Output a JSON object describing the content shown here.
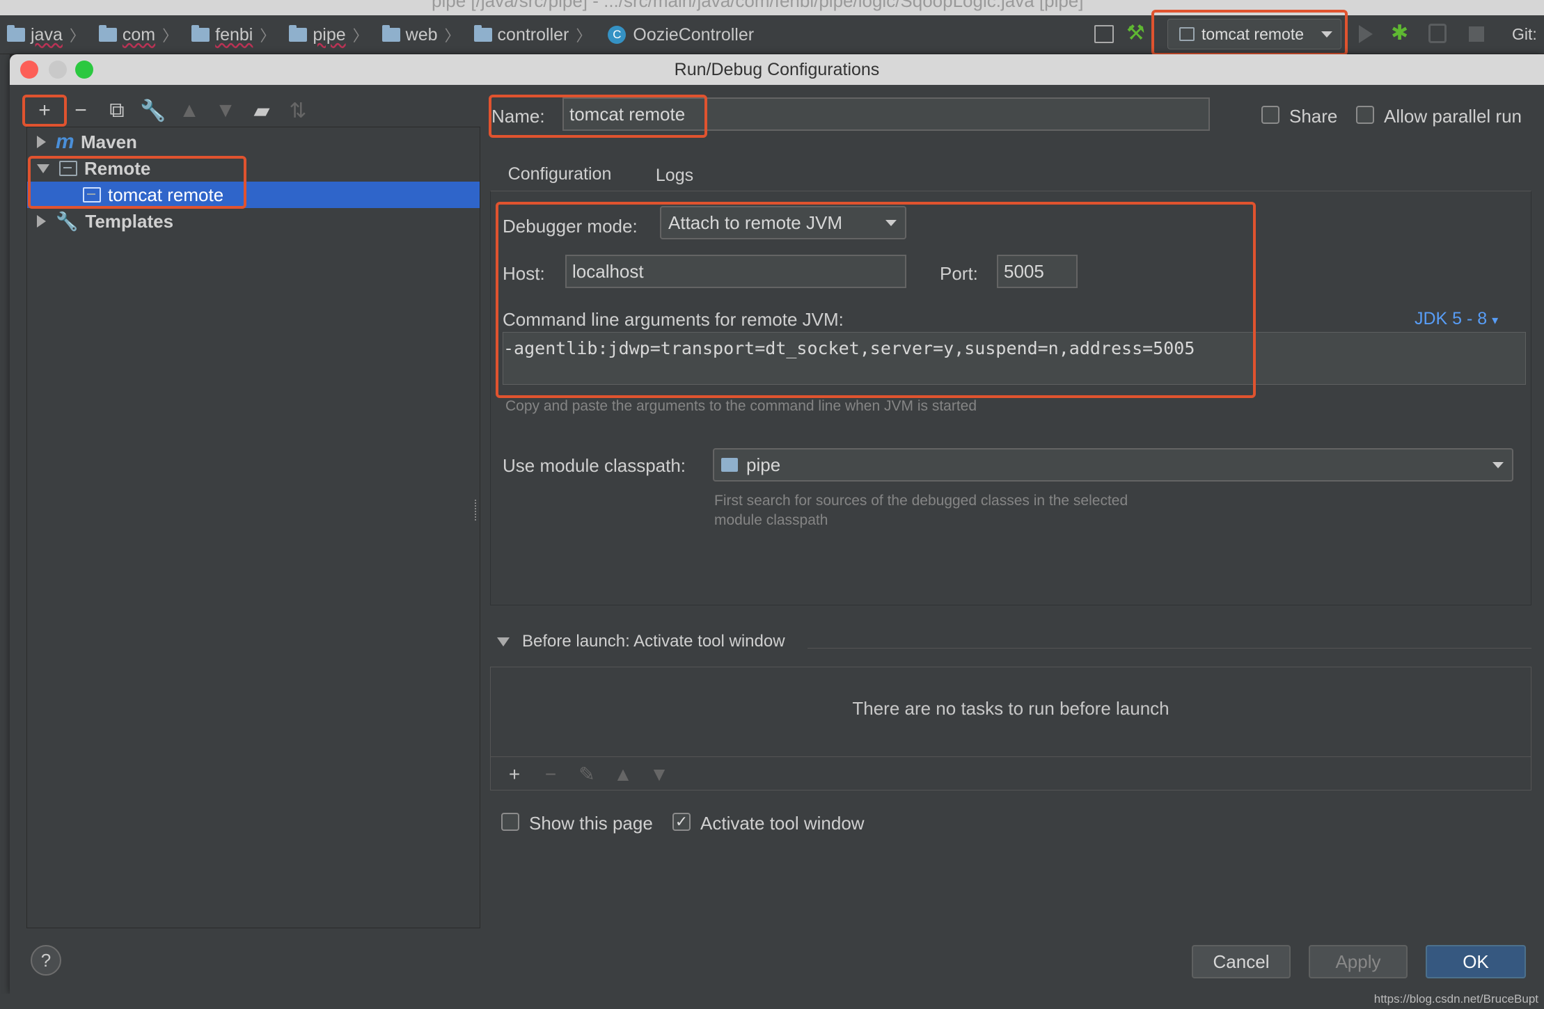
{
  "window_title": "pipe [/java/src/pipe] - .../src/main/java/com/fenbi/pipe/logic/SqoopLogic.java [pipe]",
  "breadcrumbs": [
    {
      "label": "java",
      "icon": "folder-icon"
    },
    {
      "label": "com",
      "icon": "folder-icon"
    },
    {
      "label": "fenbi",
      "icon": "folder-icon"
    },
    {
      "label": "pipe",
      "icon": "folder-icon"
    },
    {
      "label": "web",
      "icon": "folder-icon"
    },
    {
      "label": "controller",
      "icon": "folder-icon"
    },
    {
      "label": "OozieController",
      "icon": "class-icon"
    }
  ],
  "toolbar": {
    "run_config_label": "tomcat remote",
    "git_label": "Git:",
    "class_glyph": "C"
  },
  "dialog": {
    "title": "Run/Debug Configurations",
    "tree": {
      "items": [
        {
          "label": "Maven",
          "icon": "maven-icon",
          "expanded": false
        },
        {
          "label": "Remote",
          "icon": "remote-icon",
          "expanded": true
        },
        {
          "label": "tomcat remote",
          "icon": "remote-icon",
          "selected": true
        },
        {
          "label": "Templates",
          "icon": "wrench-icon",
          "expanded": false
        }
      ],
      "maven_glyph": "m"
    },
    "name_label": "Name:",
    "name_value": "tomcat remote",
    "share_label": "Share",
    "share_checked": false,
    "allow_parallel_label": "Allow parallel run",
    "allow_parallel_checked": false,
    "tabs": [
      {
        "label": "Configuration",
        "active": true
      },
      {
        "label": "Logs",
        "active": false
      }
    ],
    "debugger_mode_label": "Debugger mode:",
    "debugger_mode_value": "Attach to remote JVM",
    "host_label": "Host:",
    "host_value": "localhost",
    "port_label": "Port:",
    "port_value": "5005",
    "cmd_label": "Command line arguments for remote JVM:",
    "jdk_label": "JDK 5 - 8",
    "cmd_value": "-agentlib:jdwp=transport=dt_socket,server=y,suspend=n,address=5005",
    "cmd_hint": "Copy and paste the arguments to the command line when JVM is started",
    "module_label": "Use module classpath:",
    "module_value": "pipe",
    "module_hint_1": "First search for sources of the debugged classes in the selected",
    "module_hint_2": "module classpath",
    "before_launch_title": "Before launch: Activate tool window",
    "no_tasks_msg": "There are no tasks to run before launch",
    "show_page_label": "Show this page",
    "show_page_checked": false,
    "activate_tool_label": "Activate tool window",
    "activate_tool_checked": true,
    "check_glyph": "✓",
    "help_glyph": "?",
    "buttons": {
      "cancel": "Cancel",
      "apply": "Apply",
      "ok": "OK"
    }
  },
  "watermark": "https://blog.csdn.net/BruceBupt",
  "colors": {
    "highlight": "#e0532f",
    "selection": "#2f65ca",
    "link": "#589df6",
    "primary_button": "#365880"
  }
}
